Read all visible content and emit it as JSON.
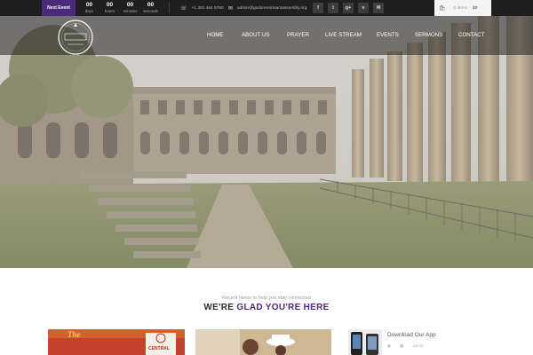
{
  "topbar": {
    "next_event_label": "Next Event",
    "countdown": [
      {
        "value": "00",
        "label": "days"
      },
      {
        "value": "00",
        "label": "hours"
      },
      {
        "value": "00",
        "label": "minutes"
      },
      {
        "value": "00",
        "label": "seconds"
      }
    ],
    "phone": "+1 301 464 5760",
    "email": "admin@godsreremnantassembly.org",
    "social": [
      {
        "icon": "facebook-icon",
        "glyph": "f"
      },
      {
        "icon": "twitter-icon",
        "glyph": "t"
      },
      {
        "icon": "google-plus-icon",
        "glyph": "g+"
      },
      {
        "icon": "vimeo-icon",
        "glyph": "v"
      },
      {
        "icon": "mail-icon",
        "glyph": "✉"
      }
    ],
    "cart": {
      "items": "0 items -",
      "price": "$0"
    }
  },
  "nav": {
    "items": [
      "HOME",
      "ABOUT US",
      "PRAYER",
      "LIVE STREAM",
      "EVENTS",
      "SERMONS",
      "CONTACT"
    ]
  },
  "section": {
    "subtitle": "Recent News to help you stay connected",
    "headline_dark": "WE'RE",
    "headline_accent": "GLAD YOU'RE HERE"
  },
  "cards": {
    "card1_text": "The",
    "card1_badge": "CENTRAL",
    "app_title": "Download Our App",
    "app_date": "Jul 01"
  },
  "colors": {
    "accent": "#4b2a7b",
    "topbar": "#1f1f1f"
  }
}
